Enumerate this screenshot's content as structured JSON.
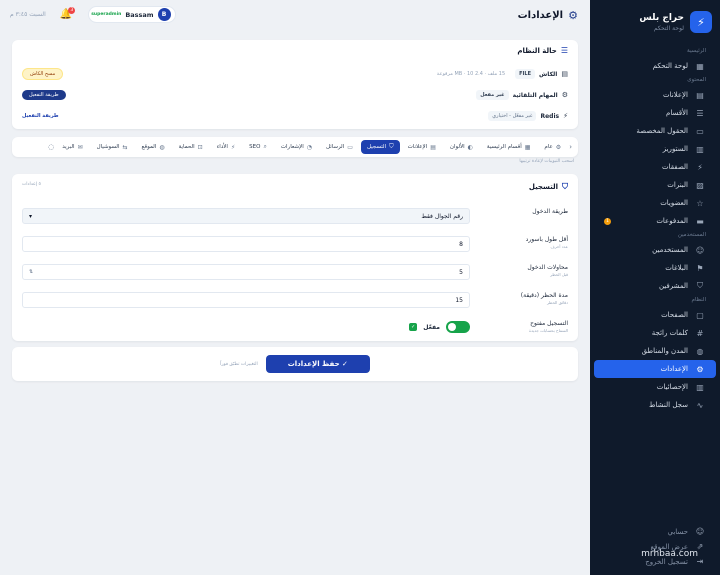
{
  "brand": {
    "title": "حراج بلس",
    "subtitle": "لوحة التحكم"
  },
  "sidebar": {
    "sections": [
      {
        "label": "الرئيسية",
        "items": [
          {
            "label": "لوحة التحكم",
            "icon": "grid-icon"
          }
        ]
      },
      {
        "label": "المحتوى",
        "items": [
          {
            "label": "الإعلانات",
            "icon": "document-icon"
          },
          {
            "label": "الأقسام",
            "icon": "list-icon"
          },
          {
            "label": "الحقول المخصصة",
            "icon": "fields-icon"
          },
          {
            "label": "الستوريز",
            "icon": "book-icon"
          },
          {
            "label": "الصفقات",
            "icon": "bolt-icon"
          },
          {
            "label": "البنرات",
            "icon": "image-icon"
          },
          {
            "label": "العضويات",
            "icon": "star-icon"
          },
          {
            "label": "المدفوعات",
            "icon": "card-icon",
            "badge": "1"
          }
        ]
      },
      {
        "label": "المستخدمين",
        "items": [
          {
            "label": "المستخدمين",
            "icon": "users-icon"
          },
          {
            "label": "البلاغات",
            "icon": "flag-icon"
          },
          {
            "label": "المشرفين",
            "icon": "shield-icon"
          }
        ]
      },
      {
        "label": "النظام",
        "items": [
          {
            "label": "الصفحات",
            "icon": "page-icon"
          },
          {
            "label": "كلمات رائجة",
            "icon": "tag-icon"
          },
          {
            "label": "المدن والمناطق",
            "icon": "globe-icon"
          },
          {
            "label": "الإعدادات",
            "icon": "gear-icon",
            "active": true
          },
          {
            "label": "الإحصائيات",
            "icon": "chart-icon"
          },
          {
            "label": "سجل النشاط",
            "icon": "activity-icon"
          }
        ]
      }
    ],
    "bottom": [
      {
        "label": "حسابي",
        "icon": "user-icon"
      },
      {
        "label": "عرض الموقع",
        "icon": "link-icon"
      },
      {
        "label": "تسجيل الخروج",
        "icon": "logout-icon"
      }
    ]
  },
  "header": {
    "title": "الإعدادات",
    "date": "السبت ٣:٤٥ م",
    "notif_count": "3",
    "user_name": "Bassam",
    "user_role": "superadmin",
    "user_initial": "B"
  },
  "system_status": {
    "title": "حالة النظام",
    "rows": [
      {
        "label": "الكاش",
        "pill": "FILE",
        "info": "15 ملف · 2.4 MB · 10 مرفوعة",
        "action": "مسح الكاش"
      },
      {
        "label": "المهام التلقائية",
        "pill": "غير مفعل",
        "info": "",
        "action": "طريقة التفعيل"
      },
      {
        "label": "Redis",
        "pill": "",
        "info": "غير مفعّل - اختياري",
        "action": "طريقة التفعيل"
      }
    ]
  },
  "tabs": [
    {
      "label": "عام",
      "icon": "gear-icon"
    },
    {
      "label": "أقسام الرئيسية",
      "icon": "grid-icon"
    },
    {
      "label": "الألوان",
      "icon": "palette-icon"
    },
    {
      "label": "الإعلانات",
      "icon": "document-icon"
    },
    {
      "label": "التسجيل",
      "icon": "shield-icon",
      "active": true
    },
    {
      "label": "الرسائل",
      "icon": "chat-icon"
    },
    {
      "label": "الإشعارات",
      "icon": "bell-icon"
    },
    {
      "label": "SEO",
      "icon": "search-icon"
    },
    {
      "label": "الأداء",
      "icon": "bolt-icon"
    },
    {
      "label": "الحماية",
      "icon": "lock-icon"
    },
    {
      "label": "الموقع",
      "icon": "globe-icon"
    },
    {
      "label": "السوشيال",
      "icon": "share-icon"
    },
    {
      "label": "البريد",
      "icon": "mail-icon"
    }
  ],
  "tabs_hint": "اسحب التبويبات لإعادة ترتيبها",
  "registration": {
    "title": "التسجيل",
    "note": "٥ إعدادات",
    "fields": [
      {
        "label": "طريقة الدخول",
        "sub": "",
        "value": "رقم الجوال فقط"
      },
      {
        "label": "أقل طول باسورد",
        "sub": "عدد أحرف",
        "value": "8"
      },
      {
        "label": "محاولات الدخول",
        "sub": "قبل الحظر",
        "value": "5"
      },
      {
        "label": "مدة الحظر (دقيقة)",
        "sub": "دقائق الحظر",
        "value": "15"
      },
      {
        "label": "التسجيل مفتوح",
        "sub": "السماح بحسابات جديدة",
        "value": "مفعّل"
      }
    ]
  },
  "footer": {
    "save_label": "حفظ الإعدادات",
    "note": "التغييرات تطبّق فوراً"
  },
  "watermark": "mrhbaa.com"
}
